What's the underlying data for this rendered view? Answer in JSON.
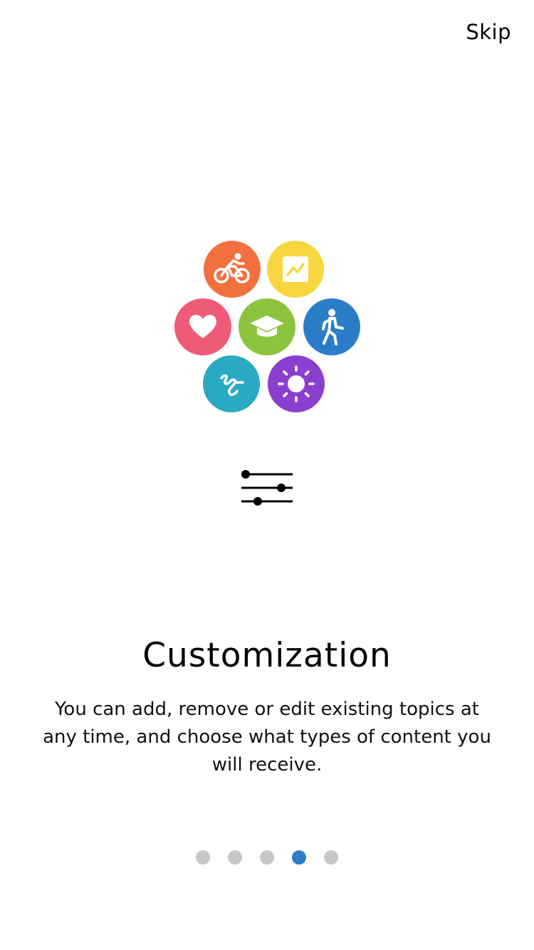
{
  "header": {
    "skip_label": "Skip"
  },
  "illustration": {
    "bubbles": [
      {
        "name": "bicycle-icon",
        "color": "#f2703d"
      },
      {
        "name": "chart-icon",
        "color": "#f8d63f"
      },
      {
        "name": "heart-icon",
        "color": "#ef5a76"
      },
      {
        "name": "graduation-cap-icon",
        "color": "#8cc43f"
      },
      {
        "name": "walking-person-icon",
        "color": "#2b7dc8"
      },
      {
        "name": "swimmer-icon",
        "color": "#2aa9c2"
      },
      {
        "name": "sun-icon",
        "color": "#8b3ecf"
      }
    ],
    "feature_icon": "sliders-icon"
  },
  "content": {
    "title": "Customization",
    "description": "You can add, remove or edit existing topics at any time, and choose what types of content you will receive."
  },
  "pagination": {
    "total_pages": 5,
    "active_page": 4,
    "active_color": "#2b7dc8",
    "inactive_color": "#c8c8c8"
  }
}
